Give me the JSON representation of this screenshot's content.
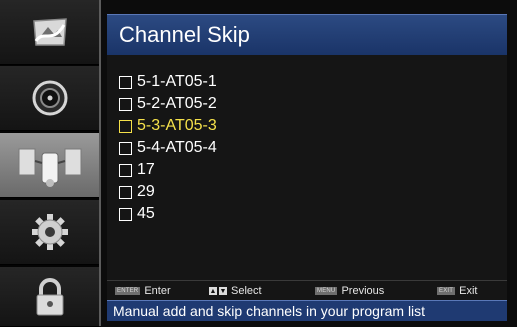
{
  "sidebar": {
    "items": [
      {
        "icon": "picture-icon",
        "active": false
      },
      {
        "icon": "audio-icon",
        "active": false
      },
      {
        "icon": "channel-antenna-icon",
        "active": true
      },
      {
        "icon": "settings-gear-icon",
        "active": false
      },
      {
        "icon": "lock-icon",
        "active": false
      }
    ]
  },
  "menu": {
    "title": "Channel Skip",
    "channels": [
      {
        "label": "5-1-AT05-1",
        "selected": false
      },
      {
        "label": "5-2-AT05-2",
        "selected": false
      },
      {
        "label": "5-3-AT05-3",
        "selected": true
      },
      {
        "label": "5-4-AT05-4",
        "selected": false
      },
      {
        "label": "17",
        "selected": false
      },
      {
        "label": "29",
        "selected": false
      },
      {
        "label": "45",
        "selected": false
      }
    ]
  },
  "help": {
    "enter": {
      "key": "ENTER",
      "label": "Enter"
    },
    "select": {
      "label": "Select"
    },
    "previous": {
      "key": "MENU",
      "label": "Previous"
    },
    "exit": {
      "key": "EXIT",
      "label": "Exit"
    }
  },
  "status": "Manual add and skip channels in your program list",
  "colors": {
    "highlight": "#f5e14a",
    "title_bar": "#2c4a82",
    "status_bar": "#1f3a72"
  }
}
